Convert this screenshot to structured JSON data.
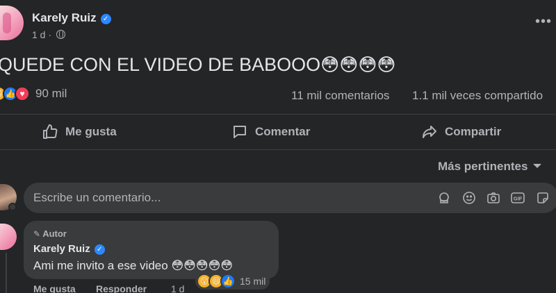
{
  "post": {
    "author": "Karely Ruiz",
    "time": "1 d ·",
    "text": "QUEDE CON EL VIDEO DE BABOOO",
    "text_emojis": "😳😳😳😳",
    "reactions_count": "90 mil",
    "comments_count": "11 mil comentarios",
    "shares_count": "1.1 mil veces compartido"
  },
  "actions": {
    "like": "Me gusta",
    "comment": "Comentar",
    "share": "Compartir"
  },
  "sort_label": "Más pertinentes",
  "composer": {
    "placeholder": "Escribe un comentario..."
  },
  "comment": {
    "badge": "Autor",
    "author": "Karely Ruiz",
    "text": "Ami me invito a ese video",
    "text_emojis": "😳😳😳😳😳",
    "reactions_count": "15 mil",
    "like": "Me gusta",
    "reply": "Responder",
    "time": "1 d"
  },
  "colors": {
    "background": "#242526",
    "surface": "#3a3b3c",
    "text_primary": "#e4e6eb",
    "text_secondary": "#b0b3b8",
    "verified": "#2d88ff",
    "like": "#2078f4",
    "love": "#f33e58",
    "haha": "#f7b125"
  },
  "icons": [
    "globe-icon",
    "more-icon",
    "verified-icon",
    "like-icon",
    "comment-icon",
    "share-icon",
    "chevron-down-icon",
    "sticker-icon",
    "emoji-icon",
    "camera-icon",
    "gif-icon",
    "avatar-sticker-icon",
    "microphone-icon"
  ]
}
